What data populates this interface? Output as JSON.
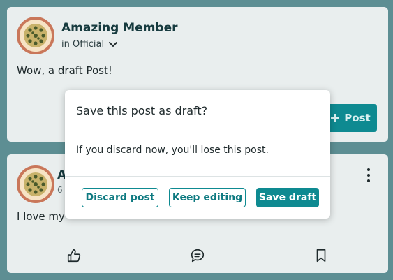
{
  "composer": {
    "author_name": "Amazing Member",
    "scope": "in Official",
    "text": "Wow, a draft Post!",
    "post_button": "Post"
  },
  "feed_post": {
    "author_initial": "A",
    "timestamp": "6",
    "text": "I love my"
  },
  "dialog": {
    "title": "Save this post as draft?",
    "body": "If you discard now, you'll lose this post.",
    "discard_label": "Discard post",
    "keep_label": "Keep editing",
    "save_label": "Save draft"
  },
  "colors": {
    "backdrop": "#5d8e93",
    "accent": "#0e8a91",
    "card": "#e9eeee"
  },
  "icons": {
    "avatar": "passion-fruit-avatar",
    "scope_toggle": "chevron-down-icon",
    "post_plus": "plus-icon",
    "more": "more-vertical-icon",
    "like": "thumbs-up-icon",
    "comment": "comment-icon",
    "save": "bookmark-icon"
  }
}
